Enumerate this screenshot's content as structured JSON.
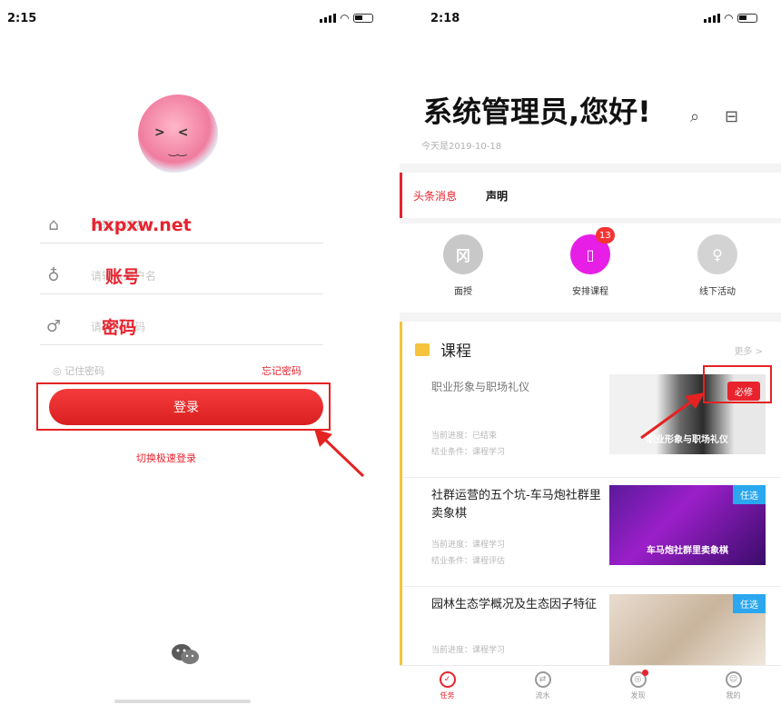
{
  "left": {
    "status": {
      "time": "2:15"
    },
    "fields": [
      {
        "icon": "home-icon",
        "overlay": "hxpxw.net",
        "placeholder": "请输入域名"
      },
      {
        "icon": "user-icon",
        "overlay": "账号",
        "placeholder": "请输入用户名"
      },
      {
        "icon": "key-icon",
        "overlay": "密码",
        "placeholder": "请输入密码"
      }
    ],
    "remember_label": "◎ 记住密码",
    "forget_label": "忘记密码",
    "login_button": "登录",
    "switch_label": "切换极速登录"
  },
  "right": {
    "status": {
      "time": "2:18"
    },
    "greeting": "系统管理员,您好!",
    "date_label": "今天是2019-10-18",
    "tabs": [
      "头条消息",
      "声明"
    ],
    "icons": [
      {
        "label": "面授",
        "glyph": "冈",
        "color": "#c8c8c8"
      },
      {
        "label": "安排课程",
        "glyph": "▯",
        "color": "#e61ee6",
        "badge": "13"
      },
      {
        "label": "线下活动",
        "glyph": "♀",
        "color": "#d3d3d3"
      }
    ],
    "courses_section": {
      "title": "课程",
      "more_label": "更多 >"
    },
    "courses": [
      {
        "name": "职业形象与职场礼仪",
        "meta1": "当前进度：已结束",
        "meta2": "结业条件：课程学习",
        "tag": "必修",
        "tag_color": "#e8232e",
        "thumb_caption": "职业形象与职场礼仪"
      },
      {
        "name": "社群运营的五个坑-车马炮社群里卖象棋",
        "meta1": "当前进度：课程学习",
        "meta2": "结业条件：课程评估",
        "tag": "任选",
        "tag_color": "#2aa7ee",
        "thumb_caption": "车马炮社群里卖象棋"
      },
      {
        "name": "园林生态学概况及生态因子特征",
        "meta1": "当前进度：课程学习",
        "meta2": "",
        "tag": "任选",
        "tag_color": "#2aa7ee",
        "thumb_caption": ""
      }
    ],
    "tabbar": [
      {
        "label": "任务",
        "icon": "check-icon"
      },
      {
        "label": "流水",
        "icon": "flow-icon"
      },
      {
        "label": "发现",
        "icon": "discover-icon"
      },
      {
        "label": "我的",
        "icon": "profile-icon"
      }
    ]
  }
}
